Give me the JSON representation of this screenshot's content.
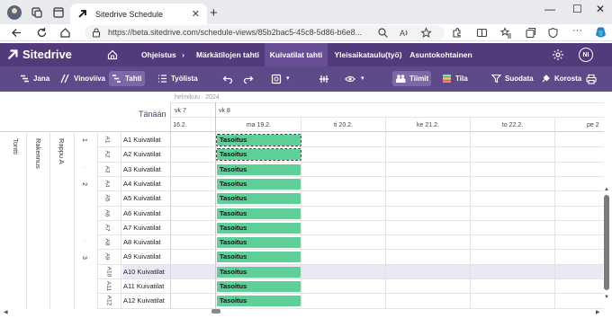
{
  "browser": {
    "tab_title": "Sitedrive Schedule",
    "url": "https://beta.sitedrive.com/schedule-views/85b2bac5-45c8-5d86-b6e8...",
    "window_controls": [
      "minimize-icon",
      "maximize-icon",
      "close-icon"
    ],
    "toolbar_icons": [
      "back-arrow-icon",
      "reload-icon",
      "home-icon",
      "lock-icon",
      "zoom-icon",
      "read-aloud-icon",
      "favorite-star-icon",
      "extensions-icon",
      "split-screen-icon",
      "favorites-icon",
      "collections-icon",
      "copilot-icon"
    ]
  },
  "app": {
    "brand": "Sitedrive",
    "nav": [
      {
        "label": "Ohjeistus",
        "has_chevron": true
      },
      {
        "label": "Märkätilojen tahti"
      },
      {
        "label": "Kuivatilat tahti",
        "active": true
      },
      {
        "label": "Yleisaikataulu(työ)"
      },
      {
        "label": "Asuntokohtainen"
      }
    ],
    "avatar_initials": "NI",
    "accent_color": "#533a7b"
  },
  "toolbar": {
    "jana": "Jana",
    "vinoviiva": "Vinoviiva",
    "tahti": "Tahti",
    "tyolista": "Työlista",
    "tiimit": "Tiimit",
    "tila": "Tila",
    "suodata": "Suodata",
    "korosta": "Korosta"
  },
  "gantt": {
    "today_label": "Tänään",
    "month": "helmikuu · 2024",
    "weeks": [
      "vk 7",
      "vk 8"
    ],
    "days": [
      "16.2.",
      "ma 19.2.",
      "ti 20.2.",
      "ke 21.2.",
      "to 22.2.",
      "pe 2"
    ],
    "hierarchy": [
      "Tontti",
      "Rakennus",
      "Rappu A"
    ],
    "floors": [
      "1",
      "2",
      "3"
    ],
    "rows": [
      {
        "sub": "A1",
        "label": "A1 Kuivatilat",
        "task": "Tasoitus"
      },
      {
        "sub": "A2",
        "label": "A2 Kuivatilat",
        "task": "Tasoitus"
      },
      {
        "sub": "A3",
        "label": "A3 Kuivatilat",
        "task": "Tasoitus"
      },
      {
        "sub": "A4",
        "label": "A4 Kuivatilat",
        "task": "Tasoitus"
      },
      {
        "sub": "A5",
        "label": "A5 Kuivatilat",
        "task": "Tasoitus"
      },
      {
        "sub": "A6",
        "label": "A6 Kuivatilat",
        "task": "Tasoitus"
      },
      {
        "sub": "A7",
        "label": "A7 Kuivatilat",
        "task": "Tasoitus"
      },
      {
        "sub": "A8",
        "label": "A8 Kuivatilat",
        "task": "Tasoitus"
      },
      {
        "sub": "A9",
        "label": "A9 Kuivatilat",
        "task": "Tasoitus"
      },
      {
        "sub": "A10",
        "label": "A10 Kuivatilat",
        "task": "Tasoitus"
      },
      {
        "sub": "A11",
        "label": "A11 Kuivatilat",
        "task": "Tasoitus"
      },
      {
        "sub": "A12",
        "label": "A12 Kuivatilat",
        "task": "Tasoitus"
      }
    ],
    "task_color": "#5ecf97",
    "highlight_row_color": "#ece6f6"
  }
}
